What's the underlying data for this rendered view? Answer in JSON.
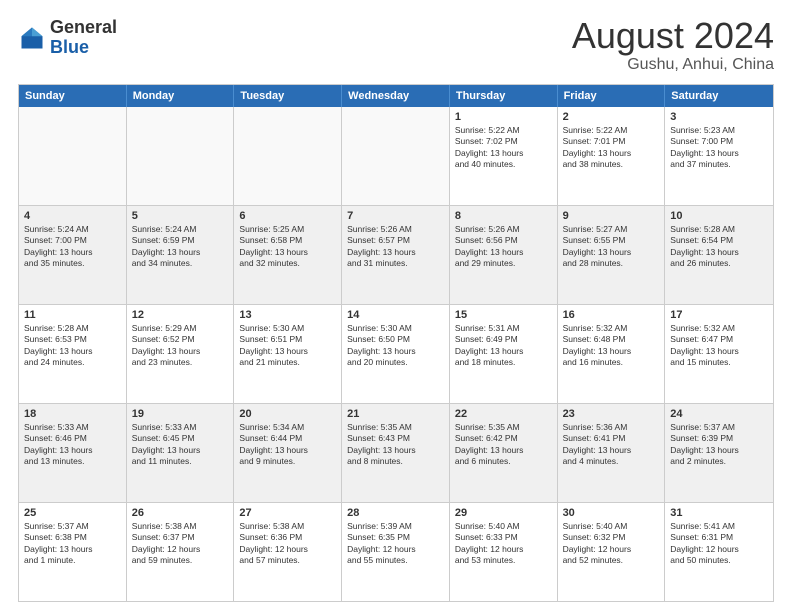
{
  "header": {
    "logo": {
      "general": "General",
      "blue": "Blue"
    },
    "title": "August 2024",
    "location": "Gushu, Anhui, China"
  },
  "weekdays": [
    "Sunday",
    "Monday",
    "Tuesday",
    "Wednesday",
    "Thursday",
    "Friday",
    "Saturday"
  ],
  "rows": [
    [
      {
        "day": "",
        "info": "",
        "empty": true
      },
      {
        "day": "",
        "info": "",
        "empty": true
      },
      {
        "day": "",
        "info": "",
        "empty": true
      },
      {
        "day": "",
        "info": "",
        "empty": true
      },
      {
        "day": "1",
        "info": "Sunrise: 5:22 AM\nSunset: 7:02 PM\nDaylight: 13 hours\nand 40 minutes."
      },
      {
        "day": "2",
        "info": "Sunrise: 5:22 AM\nSunset: 7:01 PM\nDaylight: 13 hours\nand 38 minutes."
      },
      {
        "day": "3",
        "info": "Sunrise: 5:23 AM\nSunset: 7:00 PM\nDaylight: 13 hours\nand 37 minutes."
      }
    ],
    [
      {
        "day": "4",
        "info": "Sunrise: 5:24 AM\nSunset: 7:00 PM\nDaylight: 13 hours\nand 35 minutes."
      },
      {
        "day": "5",
        "info": "Sunrise: 5:24 AM\nSunset: 6:59 PM\nDaylight: 13 hours\nand 34 minutes."
      },
      {
        "day": "6",
        "info": "Sunrise: 5:25 AM\nSunset: 6:58 PM\nDaylight: 13 hours\nand 32 minutes."
      },
      {
        "day": "7",
        "info": "Sunrise: 5:26 AM\nSunset: 6:57 PM\nDaylight: 13 hours\nand 31 minutes."
      },
      {
        "day": "8",
        "info": "Sunrise: 5:26 AM\nSunset: 6:56 PM\nDaylight: 13 hours\nand 29 minutes."
      },
      {
        "day": "9",
        "info": "Sunrise: 5:27 AM\nSunset: 6:55 PM\nDaylight: 13 hours\nand 28 minutes."
      },
      {
        "day": "10",
        "info": "Sunrise: 5:28 AM\nSunset: 6:54 PM\nDaylight: 13 hours\nand 26 minutes."
      }
    ],
    [
      {
        "day": "11",
        "info": "Sunrise: 5:28 AM\nSunset: 6:53 PM\nDaylight: 13 hours\nand 24 minutes."
      },
      {
        "day": "12",
        "info": "Sunrise: 5:29 AM\nSunset: 6:52 PM\nDaylight: 13 hours\nand 23 minutes."
      },
      {
        "day": "13",
        "info": "Sunrise: 5:30 AM\nSunset: 6:51 PM\nDaylight: 13 hours\nand 21 minutes."
      },
      {
        "day": "14",
        "info": "Sunrise: 5:30 AM\nSunset: 6:50 PM\nDaylight: 13 hours\nand 20 minutes."
      },
      {
        "day": "15",
        "info": "Sunrise: 5:31 AM\nSunset: 6:49 PM\nDaylight: 13 hours\nand 18 minutes."
      },
      {
        "day": "16",
        "info": "Sunrise: 5:32 AM\nSunset: 6:48 PM\nDaylight: 13 hours\nand 16 minutes."
      },
      {
        "day": "17",
        "info": "Sunrise: 5:32 AM\nSunset: 6:47 PM\nDaylight: 13 hours\nand 15 minutes."
      }
    ],
    [
      {
        "day": "18",
        "info": "Sunrise: 5:33 AM\nSunset: 6:46 PM\nDaylight: 13 hours\nand 13 minutes."
      },
      {
        "day": "19",
        "info": "Sunrise: 5:33 AM\nSunset: 6:45 PM\nDaylight: 13 hours\nand 11 minutes."
      },
      {
        "day": "20",
        "info": "Sunrise: 5:34 AM\nSunset: 6:44 PM\nDaylight: 13 hours\nand 9 minutes."
      },
      {
        "day": "21",
        "info": "Sunrise: 5:35 AM\nSunset: 6:43 PM\nDaylight: 13 hours\nand 8 minutes."
      },
      {
        "day": "22",
        "info": "Sunrise: 5:35 AM\nSunset: 6:42 PM\nDaylight: 13 hours\nand 6 minutes."
      },
      {
        "day": "23",
        "info": "Sunrise: 5:36 AM\nSunset: 6:41 PM\nDaylight: 13 hours\nand 4 minutes."
      },
      {
        "day": "24",
        "info": "Sunrise: 5:37 AM\nSunset: 6:39 PM\nDaylight: 13 hours\nand 2 minutes."
      }
    ],
    [
      {
        "day": "25",
        "info": "Sunrise: 5:37 AM\nSunset: 6:38 PM\nDaylight: 13 hours\nand 1 minute."
      },
      {
        "day": "26",
        "info": "Sunrise: 5:38 AM\nSunset: 6:37 PM\nDaylight: 12 hours\nand 59 minutes."
      },
      {
        "day": "27",
        "info": "Sunrise: 5:38 AM\nSunset: 6:36 PM\nDaylight: 12 hours\nand 57 minutes."
      },
      {
        "day": "28",
        "info": "Sunrise: 5:39 AM\nSunset: 6:35 PM\nDaylight: 12 hours\nand 55 minutes."
      },
      {
        "day": "29",
        "info": "Sunrise: 5:40 AM\nSunset: 6:33 PM\nDaylight: 12 hours\nand 53 minutes."
      },
      {
        "day": "30",
        "info": "Sunrise: 5:40 AM\nSunset: 6:32 PM\nDaylight: 12 hours\nand 52 minutes."
      },
      {
        "day": "31",
        "info": "Sunrise: 5:41 AM\nSunset: 6:31 PM\nDaylight: 12 hours\nand 50 minutes."
      }
    ]
  ]
}
